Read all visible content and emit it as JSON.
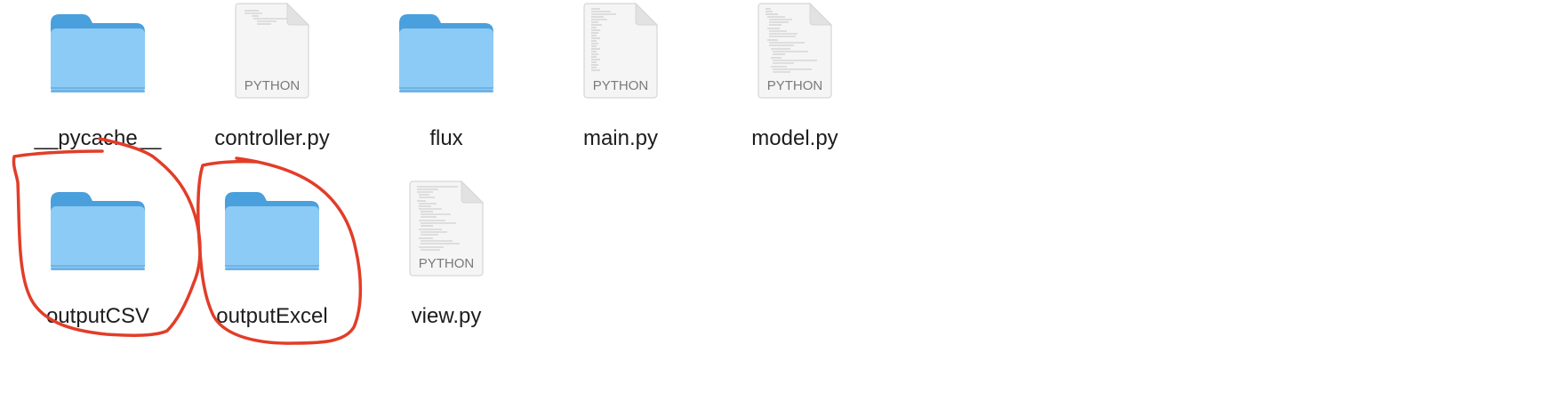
{
  "items": [
    {
      "name": "__pycache__",
      "kind": "folder",
      "icon": "folder-icon"
    },
    {
      "name": "controller.py",
      "kind": "python-file",
      "icon": "python-file-icon",
      "badge": "PYTHON"
    },
    {
      "name": "flux",
      "kind": "folder",
      "icon": "folder-icon"
    },
    {
      "name": "main.py",
      "kind": "python-file",
      "icon": "python-file-icon",
      "badge": "PYTHON"
    },
    {
      "name": "model.py",
      "kind": "python-file",
      "icon": "python-file-icon",
      "badge": "PYTHON"
    },
    {
      "name": "outputCSV",
      "kind": "folder",
      "icon": "folder-icon"
    },
    {
      "name": "outputExcel",
      "kind": "folder",
      "icon": "folder-icon"
    },
    {
      "name": "view.py",
      "kind": "python-file",
      "icon": "python-file-icon",
      "badge": "PYTHON"
    }
  ],
  "colors": {
    "folder_back": "#4a9fdd",
    "folder_front": "#8ccbf5",
    "folder_shadow": "#6fb3e6",
    "annotation_stroke": "#e23d28",
    "label_text": "#1d1d1f"
  },
  "annotations": [
    {
      "type": "freehand-circle",
      "target": "outputCSV"
    },
    {
      "type": "freehand-circle",
      "target": "outputExcel"
    }
  ]
}
